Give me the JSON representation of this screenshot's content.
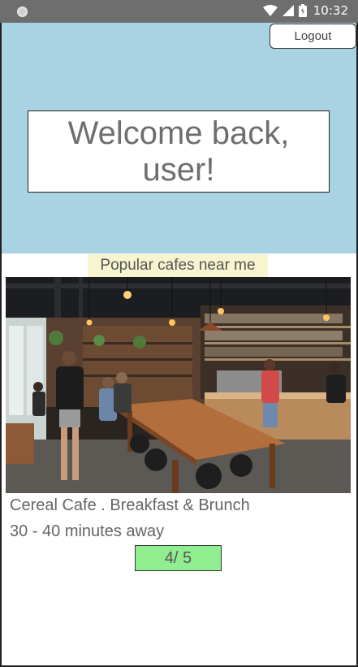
{
  "status_bar": {
    "time": "10:32",
    "icons": [
      "notification-dot-icon",
      "wifi-icon",
      "cell-signal-icon",
      "battery-icon"
    ]
  },
  "header": {
    "logout_label": "Logout",
    "welcome_text": "Welcome back, user!"
  },
  "popular": {
    "title": "Popular cafes near me",
    "cafe": {
      "name": "Cereal Cafe . Breakfast & Brunch",
      "distance": "30 - 40 minutes away",
      "rating": "4/ 5"
    }
  },
  "colors": {
    "hero_background": "#a9d3e2",
    "section_title_background": "#f7f5d0",
    "rating_background": "#90ee90",
    "status_bar": "#6e6e6e"
  }
}
